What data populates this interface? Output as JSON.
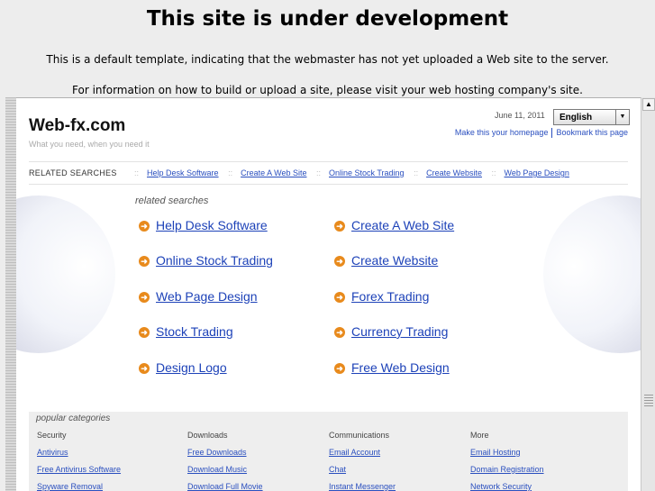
{
  "notice": {
    "title": "This site is under development",
    "line1": "This is a default template, indicating that the webmaster has not yet uploaded a Web site to the server.",
    "line2": "For information on how to build or upload a site, please visit your web hosting company's site."
  },
  "site": {
    "logo": "Web-fx.com",
    "tagline": "What you need, when you need it",
    "date": "June 11, 2011",
    "language": "English",
    "make_homepage": "Make this your homepage",
    "bookmark": "Bookmark this page"
  },
  "related_bar": {
    "label": "RELATED SEARCHES",
    "separator": "::",
    "links": [
      "Help Desk Software",
      "Create A Web Site",
      "Online Stock Trading",
      "Create Website",
      "Web Page Design"
    ]
  },
  "related_searches": {
    "heading": "related searches",
    "left": [
      "Help Desk Software",
      "Online Stock Trading",
      "Web Page Design",
      "Stock Trading",
      "Design Logo"
    ],
    "right": [
      "Create A Web Site",
      "Create Website",
      "Forex Trading",
      "Currency Trading",
      "Free Web Design"
    ]
  },
  "popular": {
    "heading": "popular categories",
    "columns": [
      {
        "head": "Security",
        "links": [
          "Antivirus",
          "Free Antivirus Software",
          "Spyware Removal"
        ]
      },
      {
        "head": "Downloads",
        "links": [
          "Free Downloads",
          "Download Music",
          "Download Full Movie"
        ]
      },
      {
        "head": "Communications",
        "links": [
          "Email Account",
          "Chat",
          "Instant Messenger"
        ]
      },
      {
        "head": "More",
        "links": [
          "Email Hosting",
          "Domain Registration",
          "Network Security"
        ]
      }
    ]
  },
  "icons": {
    "bullet": "arrow-circle-icon",
    "scroll_up": "scroll-up-arrow-icon",
    "dropdown": "chevron-down-icon"
  },
  "colors": {
    "link": "#1d42b8",
    "bullet": "#e88a1c",
    "page_bg": "#ededed"
  }
}
